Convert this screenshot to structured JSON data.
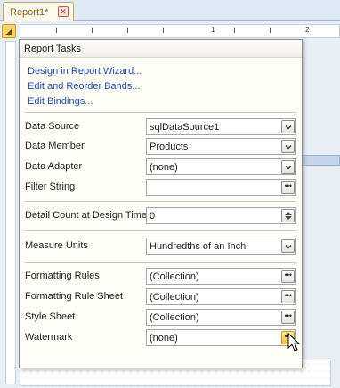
{
  "document_tab": {
    "title": "Report1*"
  },
  "ruler": {
    "marks": [
      "1",
      "2"
    ]
  },
  "panel": {
    "title": "Report Tasks",
    "links": [
      "Design in Report Wizard...",
      "Edit and Reorder Bands...",
      "Edit Bindings..."
    ],
    "properties": {
      "data_source": {
        "label": "Data Source",
        "value": "sqlDataSource1"
      },
      "data_member": {
        "label": "Data Member",
        "value": "Products"
      },
      "data_adapter": {
        "label": "Data Adapter",
        "value": "(none)"
      },
      "filter_string": {
        "label": "Filter String",
        "value": ""
      },
      "detail_count": {
        "label": "Detail Count at Design Time",
        "value": "0"
      },
      "measure_units": {
        "label": "Measure Units",
        "value": "Hundredths of an Inch"
      },
      "formatting_rules": {
        "label": "Formatting Rules",
        "value": "(Collection)"
      },
      "formatting_rule_sheet": {
        "label": "Formatting Rule Sheet",
        "value": "(Collection)"
      },
      "style_sheet": {
        "label": "Style Sheet",
        "value": "(Collection)"
      },
      "watermark": {
        "label": "Watermark",
        "value": "(none)"
      }
    }
  },
  "icons": {
    "tab_close": "close-icon",
    "dropdown": "chevron-down-icon",
    "ellipsis": "ellipsis-icon",
    "spinner": "spinner-icon",
    "cursor": "mouse-pointer-icon"
  },
  "colors": {
    "link": "#1f4ea3",
    "hot_button": "#f4c44a",
    "panel_bg": "#fffef8"
  }
}
